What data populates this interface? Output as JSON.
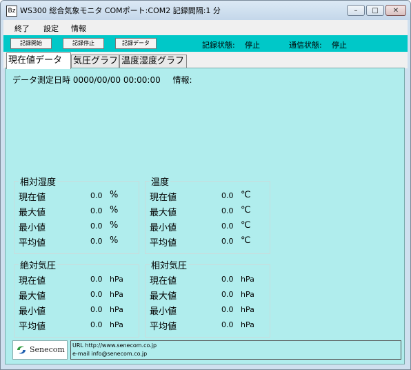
{
  "window": {
    "title": "WS300 総合気象モニタ COMポート:COM2 記録間隔:1 分",
    "icon_glyph": "Bz",
    "controls": {
      "minimize": "–",
      "maximize": "□",
      "close": "✕"
    }
  },
  "menu": [
    "終了",
    "設定",
    "情報"
  ],
  "toolbar": {
    "start_label": "記録開始",
    "stop_label": "記録停止",
    "data_label": "記録データ",
    "record_status_label": "記録状態:",
    "record_status_value": "停止",
    "comm_status_label": "通信状態:",
    "comm_status_value": "停止"
  },
  "tabs": [
    {
      "label": "現在値データ",
      "active": true
    },
    {
      "label": "気圧グラフ",
      "active": false
    },
    {
      "label": "温度湿度グラフ",
      "active": false
    }
  ],
  "measurement": {
    "datetime_label": "データ測定日時",
    "datetime_value": "0000/00/00 00:00:00",
    "info_label": "情報:"
  },
  "groups": {
    "humidity": {
      "title": "相対湿度",
      "rows": [
        {
          "label": "現在値",
          "value": "0.0",
          "unit": "%"
        },
        {
          "label": "最大値",
          "value": "0.0",
          "unit": "%"
        },
        {
          "label": "最小値",
          "value": "0.0",
          "unit": "%"
        },
        {
          "label": "平均値",
          "value": "0.0",
          "unit": "%"
        }
      ]
    },
    "temperature": {
      "title": "温度",
      "rows": [
        {
          "label": "現在値",
          "value": "0.0",
          "unit": "℃"
        },
        {
          "label": "最大値",
          "value": "0.0",
          "unit": "℃"
        },
        {
          "label": "最小値",
          "value": "0.0",
          "unit": "℃"
        },
        {
          "label": "平均値",
          "value": "0.0",
          "unit": "℃"
        }
      ]
    },
    "abs_pressure": {
      "title": "絶対気圧",
      "rows": [
        {
          "label": "現在値",
          "value": "0.0",
          "unit": "hPa"
        },
        {
          "label": "最大値",
          "value": "0.0",
          "unit": "hPa"
        },
        {
          "label": "最小値",
          "value": "0.0",
          "unit": "hPa"
        },
        {
          "label": "平均値",
          "value": "0.0",
          "unit": "hPa"
        }
      ]
    },
    "rel_pressure": {
      "title": "相対気圧",
      "rows": [
        {
          "label": "現在値",
          "value": "0.0",
          "unit": "hPa"
        },
        {
          "label": "最大値",
          "value": "0.0",
          "unit": "hPa"
        },
        {
          "label": "最小値",
          "value": "0.0",
          "unit": "hPa"
        },
        {
          "label": "平均値",
          "value": "0.0",
          "unit": "hPa"
        }
      ]
    }
  },
  "footer": {
    "logo_text": "Senecom",
    "url_line": "URL http://www.senecom.co.jp",
    "email_line": "e-mail info@senecom.co.jp"
  },
  "colors": {
    "toolbar": "#00c8c8",
    "panel": "#b0eded",
    "logo_green": "#2e9a3a",
    "logo_blue": "#1f5fb0"
  }
}
